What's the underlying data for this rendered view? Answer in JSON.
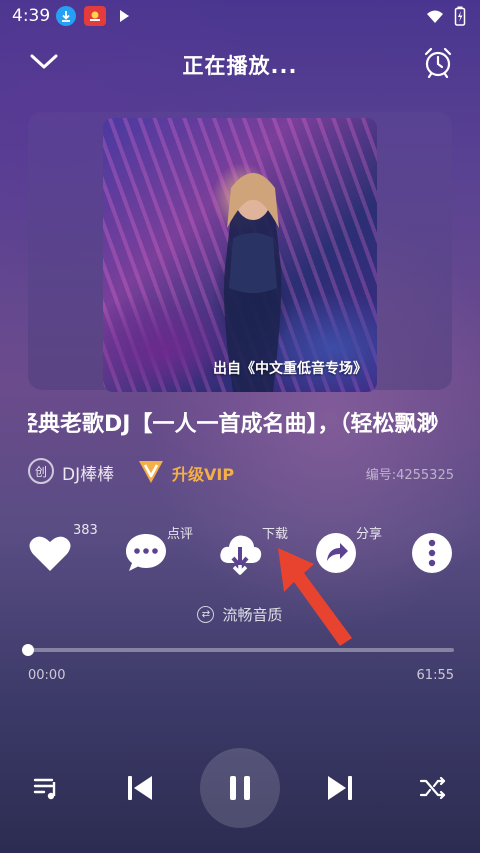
{
  "status_bar": {
    "time": "4:39",
    "icons": [
      "download-icon",
      "app-notification-icon",
      "play-icon",
      "wifi-icon",
      "battery-icon"
    ]
  },
  "header": {
    "title": "正在播放...",
    "left_icon": "chevron-down-icon",
    "right_icon": "alarm-clock-icon"
  },
  "cover": {
    "caption": "出自《中文重低音专场》"
  },
  "song": {
    "title": "经典老歌DJ【一人一首成名曲】，（轻松飘渺",
    "creator_badge": "创",
    "artist": "DJ棒棒",
    "vip_label": "升级VIP",
    "song_id": "编号:4255325"
  },
  "actions": [
    {
      "name": "like",
      "icon": "heart-icon",
      "label": "383"
    },
    {
      "name": "comment",
      "icon": "comment-icon",
      "label": "点评"
    },
    {
      "name": "download",
      "icon": "cloud-download-icon",
      "label": "下载"
    },
    {
      "name": "share",
      "icon": "share-icon",
      "label": "分享"
    },
    {
      "name": "more",
      "icon": "more-vertical-icon",
      "label": ""
    }
  ],
  "quality": {
    "icon": "switch-icon",
    "label": "流畅音质"
  },
  "progress": {
    "fraction": 0.0,
    "elapsed": "00:00",
    "total": "61:55"
  },
  "controls": [
    "playlist-icon",
    "previous-icon",
    "pause-icon",
    "next-icon",
    "shuffle-icon"
  ],
  "colors": {
    "vip": "#f4b046",
    "arrow": "#e8432f"
  }
}
